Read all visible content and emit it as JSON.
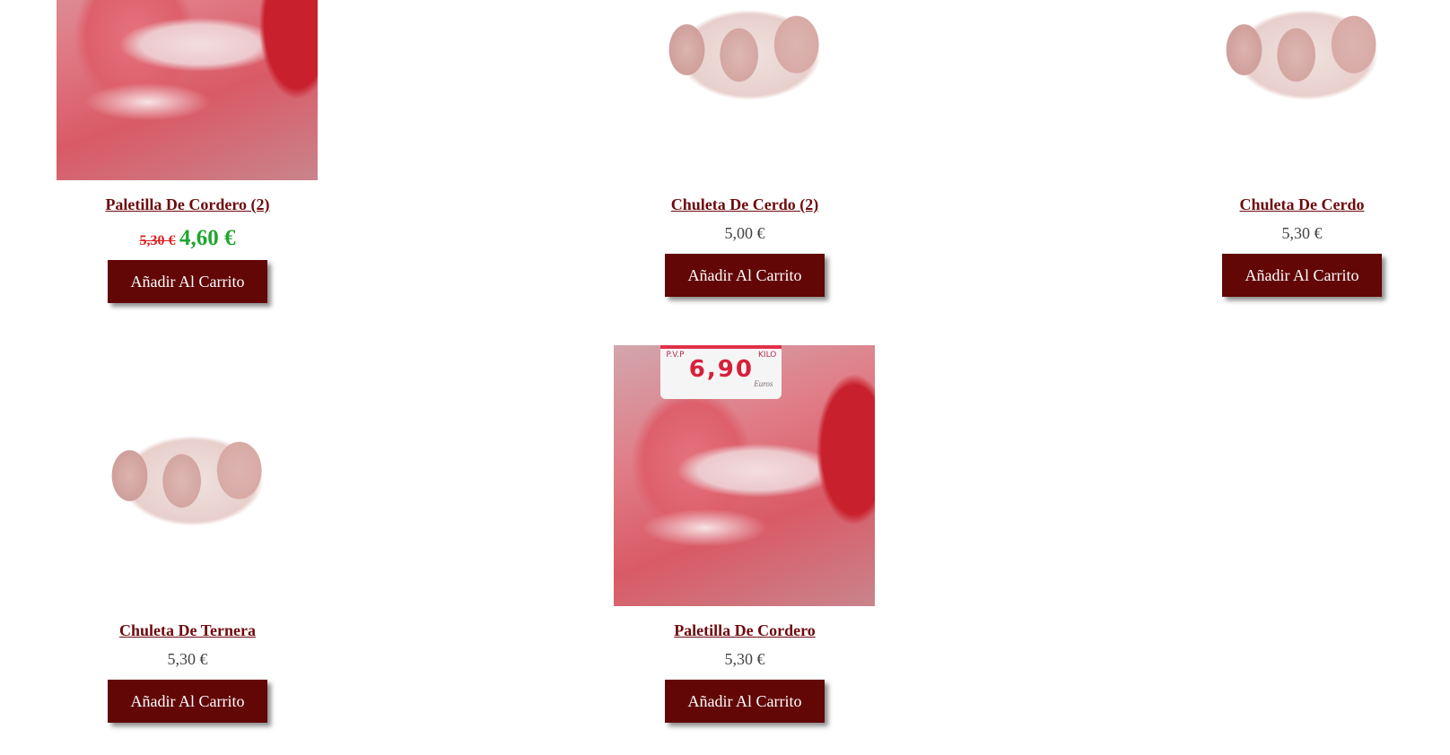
{
  "products": [
    {
      "name": "Paletilla De Cordero (2)",
      "old_price": "5,30 €",
      "price": "4,60 €",
      "button": "Añadir Al Carrito"
    },
    {
      "name": "Chuleta De Cerdo (2)",
      "price": "5,00 €",
      "button": "Añadir Al Carrito"
    },
    {
      "name": "Chuleta De Cerdo",
      "price": "5,30 €",
      "button": "Añadir Al Carrito"
    },
    {
      "name": "Chuleta De Ternera",
      "price": "5,30 €",
      "button": "Añadir Al Carrito"
    },
    {
      "name": "Paletilla De Cordero",
      "price": "5,30 €",
      "button": "Añadir Al Carrito",
      "image_tag": {
        "left": "P.V.P",
        "right": "KILO",
        "value": "6,90",
        "currency": "Euros"
      }
    }
  ],
  "colors": {
    "title": "#6e0a0e",
    "button_bg": "#620606",
    "sale_price": "#1fa62f",
    "old_price": "#d92020"
  }
}
